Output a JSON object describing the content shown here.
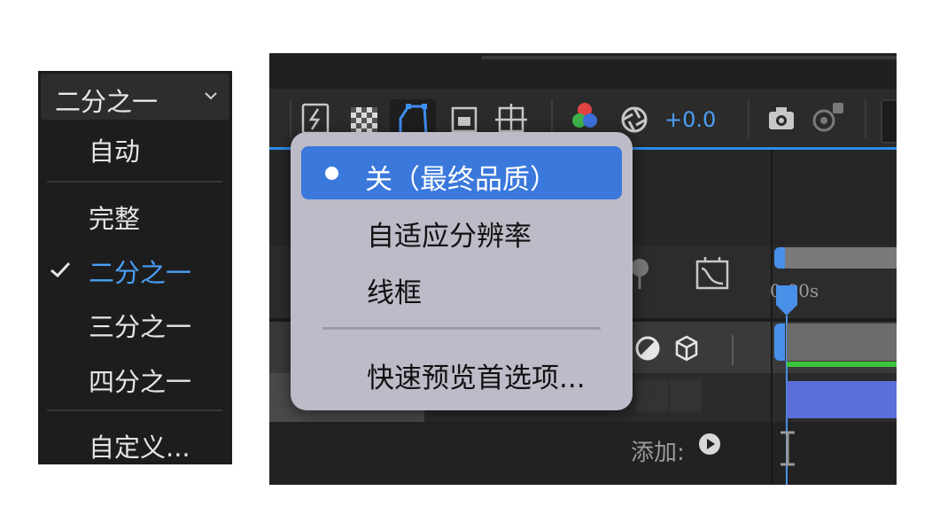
{
  "resolution_menu": {
    "selected_value": "二分之一",
    "items": [
      {
        "label": "自动"
      },
      {
        "label": "完整"
      },
      {
        "label": "二分之一"
      },
      {
        "label": "三分之一"
      },
      {
        "label": "四分之一"
      },
      {
        "label": "自定义..."
      }
    ]
  },
  "toolbar": {
    "exposure_value": "+0.0",
    "timecode": "0:00s",
    "add_label": "添加:"
  },
  "fast_preview_menu": {
    "items": [
      {
        "label": "关（最终品质）"
      },
      {
        "label": "自适应分辨率"
      },
      {
        "label": "线框"
      },
      {
        "label": "快速预览首选项..."
      }
    ]
  },
  "colors": {
    "accent_blue": "#3a78dc",
    "selected_text_blue": "#4a9ff5",
    "timeline_green": "#3cc43a",
    "layer_bar_blue": "#5b6fd8"
  }
}
